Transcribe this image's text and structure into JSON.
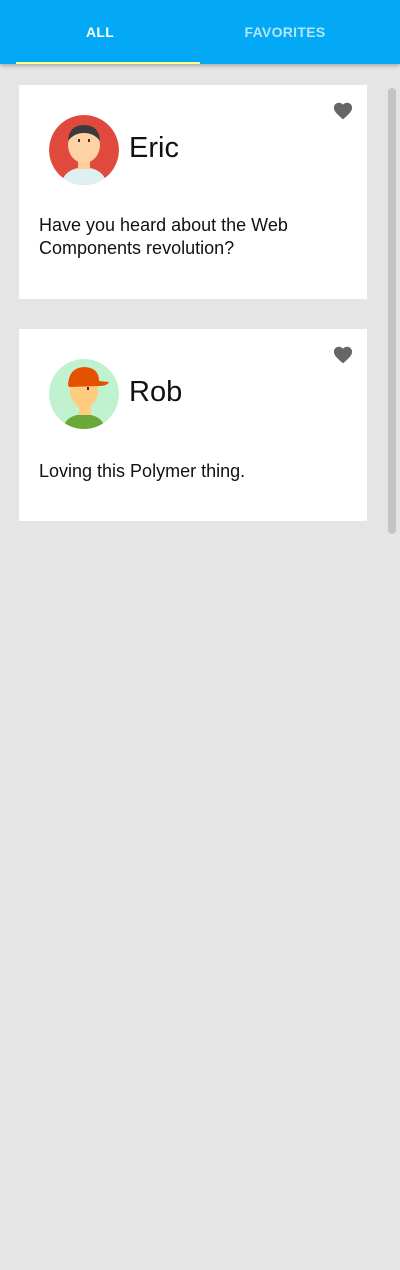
{
  "tabs": [
    {
      "label": "ALL",
      "selected": true
    },
    {
      "label": "FAVORITES",
      "selected": false
    }
  ],
  "posts": [
    {
      "name": "Eric",
      "message": "Have you heard about the Web Components revolution?",
      "avatar_icon": "avatar-eric-icon",
      "favorite_icon": "heart-icon"
    },
    {
      "name": "Rob",
      "message": "Loving this Polymer thing.",
      "avatar_icon": "avatar-rob-icon",
      "favorite_icon": "heart-icon"
    }
  ],
  "colors": {
    "toolbar": "#03a9f4",
    "tab_selected": "#ffffff",
    "tab_unselected": "#b3e5fc",
    "tab_indicator": "#ffff8d",
    "background": "#e5e5e5",
    "card": "#ffffff",
    "heart": "#666666"
  }
}
